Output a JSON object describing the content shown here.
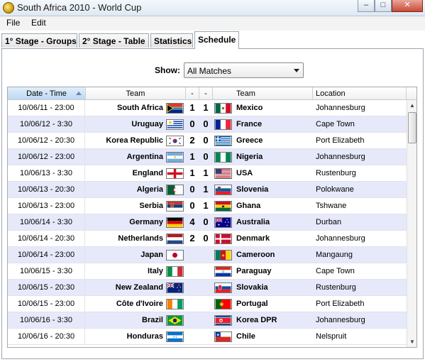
{
  "window": {
    "title": "South Africa 2010 - World Cup",
    "min_glyph": "–",
    "max_glyph": "□",
    "close_glyph": "✕"
  },
  "menu": [
    {
      "label": "File"
    },
    {
      "label": "Edit"
    }
  ],
  "tabs": [
    {
      "label": "1° Stage - Groups",
      "active": false
    },
    {
      "label": "2° Stage - Table",
      "active": false
    },
    {
      "label": "Statistics",
      "active": false
    },
    {
      "label": "Schedule",
      "active": true
    }
  ],
  "filter": {
    "label": "Show:",
    "value": "All Matches"
  },
  "table": {
    "headers": {
      "date": "Date - Time",
      "home": "Team",
      "s1": "-",
      "s2": "-",
      "away": "Team",
      "location": "Location"
    },
    "rows": [
      {
        "date": "10/06/11 - 23:00",
        "home": "South Africa",
        "home_flag": "south-africa",
        "s1": "1",
        "s2": "1",
        "away": "Mexico",
        "away_flag": "mexico",
        "location": "Johannesburg"
      },
      {
        "date": "10/06/12 - 3:30",
        "home": "Uruguay",
        "home_flag": "uruguay",
        "s1": "0",
        "s2": "0",
        "away": "France",
        "away_flag": "france",
        "location": "Cape Town"
      },
      {
        "date": "10/06/12 - 20:30",
        "home": "Korea Republic",
        "home_flag": "korea-republic",
        "s1": "2",
        "s2": "0",
        "away": "Greece",
        "away_flag": "greece",
        "location": "Port Elizabeth"
      },
      {
        "date": "10/06/12 - 23:00",
        "home": "Argentina",
        "home_flag": "argentina",
        "s1": "1",
        "s2": "0",
        "away": "Nigeria",
        "away_flag": "nigeria",
        "location": "Johannesburg"
      },
      {
        "date": "10/06/13 - 3:30",
        "home": "England",
        "home_flag": "england",
        "s1": "1",
        "s2": "1",
        "away": "USA",
        "away_flag": "usa",
        "location": "Rustenburg"
      },
      {
        "date": "10/06/13 - 20:30",
        "home": "Algeria",
        "home_flag": "algeria",
        "s1": "0",
        "s2": "1",
        "away": "Slovenia",
        "away_flag": "slovenia",
        "location": "Polokwane"
      },
      {
        "date": "10/06/13 - 23:00",
        "home": "Serbia",
        "home_flag": "serbia",
        "s1": "0",
        "s2": "1",
        "away": "Ghana",
        "away_flag": "ghana",
        "location": "Tshwane"
      },
      {
        "date": "10/06/14 - 3:30",
        "home": "Germany",
        "home_flag": "germany",
        "s1": "4",
        "s2": "0",
        "away": "Australia",
        "away_flag": "australia",
        "location": "Durban"
      },
      {
        "date": "10/06/14 - 20:30",
        "home": "Netherlands",
        "home_flag": "netherlands",
        "s1": "2",
        "s2": "0",
        "away": "Denmark",
        "away_flag": "denmark",
        "location": "Johannesburg"
      },
      {
        "date": "10/06/14 - 23:00",
        "home": "Japan",
        "home_flag": "japan",
        "s1": "",
        "s2": "",
        "away": "Cameroon",
        "away_flag": "cameroon",
        "location": "Mangaung"
      },
      {
        "date": "10/06/15 - 3:30",
        "home": "Italy",
        "home_flag": "italy",
        "s1": "",
        "s2": "",
        "away": "Paraguay",
        "away_flag": "paraguay",
        "location": "Cape Town"
      },
      {
        "date": "10/06/15 - 20:30",
        "home": "New Zealand",
        "home_flag": "new-zealand",
        "s1": "",
        "s2": "",
        "away": "Slovakia",
        "away_flag": "slovakia",
        "location": "Rustenburg"
      },
      {
        "date": "10/06/15 - 23:00",
        "home": "Côte d'Ivoire",
        "home_flag": "cote-divoire",
        "s1": "",
        "s2": "",
        "away": "Portugal",
        "away_flag": "portugal",
        "location": "Port Elizabeth"
      },
      {
        "date": "10/06/16 - 3:30",
        "home": "Brazil",
        "home_flag": "brazil",
        "s1": "",
        "s2": "",
        "away": "Korea DPR",
        "away_flag": "korea-dpr",
        "location": "Johannesburg"
      },
      {
        "date": "10/06/16 - 20:30",
        "home": "Honduras",
        "home_flag": "honduras",
        "s1": "",
        "s2": "",
        "away": "Chile",
        "away_flag": "chile",
        "location": "Nelspruit"
      }
    ]
  },
  "colors": {
    "row_alt": "#e6e9fa",
    "sorted_header": "#bcd9f3",
    "window_border": "#9aa6b2"
  }
}
